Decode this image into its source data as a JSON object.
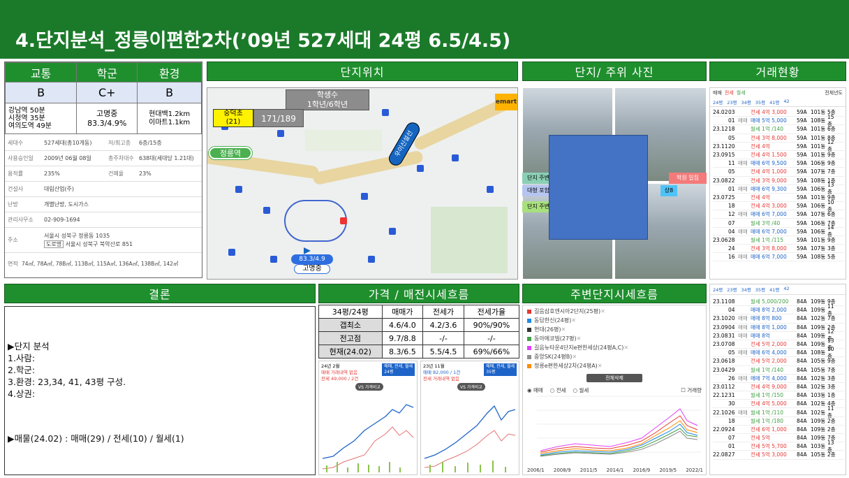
{
  "title": "4.단지분석_정릉이편한2차(’09년 527세대 24평 6.5/4.5)",
  "headers": {
    "traffic": "교통",
    "school": "학군",
    "env": "환경",
    "location": "단지위치",
    "photos": "단지/ 주위 사진",
    "deals": "거래현황",
    "conclusion": "결론",
    "price_trend": "가격 / 매전시세흐름",
    "nearby_trend": "주변단지시세흐름"
  },
  "grades": {
    "traffic": "B",
    "school": "C+",
    "env": "B"
  },
  "details": {
    "traffic": [
      "강남역 50분",
      "시청역 35분",
      "여의도역 49분"
    ],
    "school": [
      "고명중",
      "83.3/4.9%"
    ],
    "env": [
      "현대백1.2km",
      "이마트1.1km"
    ]
  },
  "info": [
    {
      "k": "세대수",
      "v": "527세대(총10개동)",
      "k2": "저/최고층",
      "v2": "6층/15층"
    },
    {
      "k": "사용승인일",
      "v": "2009년 06월 08일",
      "k2": "총주차대수",
      "v2": "638대(세대당 1.21대)"
    },
    {
      "k": "용적률",
      "v": "235%",
      "k2": "건폐율",
      "v2": "23%"
    },
    {
      "k": "건설사",
      "v": "대림산업(주)",
      "k2": "",
      "v2": ""
    },
    {
      "k": "난방",
      "v": "개별난방, 도시가스",
      "k2": "",
      "v2": ""
    },
    {
      "k": "관리사무소",
      "v": "02-909-1694",
      "k2": "",
      "v2": ""
    },
    {
      "k": "주소",
      "v": "서울시 성북구 정릉동 1035",
      "k2": "",
      "v2": ""
    },
    {
      "k": "면적",
      "v": "74㎡, 78A㎡, 78B㎡, 113B㎡, 115A㎡, 136A㎡, 138B㎡, 142㎡",
      "k2": "",
      "v2": ""
    }
  ],
  "address_road": "도로명",
  "address_road_value": "서울시 성북구 북악산로 851",
  "map": {
    "students_label": "학생수",
    "students_grades": "1학년/6학년",
    "school_name": "숭덕초",
    "school_rank": "(21)",
    "school_count": "171/189",
    "station": "정릉역",
    "emart": "emart",
    "rail": "우이신설선",
    "middle_score": "83.3/4.9",
    "middle_name": "고명중"
  },
  "photo_labels": [
    "단지 주변",
    "대형 포함",
    "단지 주변",
    "학원 밀집",
    "상8"
  ],
  "deal_tabs": {
    "sale": "매매",
    "jeonse": "전세",
    "monthly": "월세",
    "filter": "전체년도"
  },
  "deal_area_tabs": [
    "24평",
    "23평",
    "34평",
    "35평",
    "41평",
    "42"
  ],
  "deal_area_tabs2": [
    "24평",
    "23평",
    "34평",
    "35평",
    "41평",
    "42"
  ],
  "deals": [
    [
      "24.02",
      "03",
      "",
      "전세 4억 3,000",
      "59A",
      "101동",
      "5층"
    ],
    [
      "",
      "01",
      "매매",
      "매매 5억 5,000",
      "59A",
      "108동",
      "15층"
    ],
    [
      "23.12",
      "18",
      "",
      "월세 1억 /140",
      "59A",
      "101동",
      "6층"
    ],
    [
      "",
      "05",
      "",
      "전세 3억 8,000",
      "59A",
      "101동",
      "8층"
    ],
    [
      "23.11",
      "20",
      "",
      "전세 4억",
      "59A",
      "101동",
      "12층"
    ],
    [
      "23.09",
      "15",
      "",
      "전세 4억 1,500",
      "59A",
      "101동",
      "9층"
    ],
    [
      "",
      "11",
      "매매",
      "매매 6억 9,500",
      "59A",
      "106동",
      "9층"
    ],
    [
      "",
      "05",
      "",
      "전세 4억 1,000",
      "59A",
      "107동",
      "7층"
    ],
    [
      "23.08",
      "22",
      "",
      "전세 3억 9,000",
      "59A",
      "108동",
      "1층"
    ],
    [
      "",
      "01",
      "매매",
      "매매 6억 9,300",
      "59A",
      "106동",
      "13층"
    ],
    [
      "23.07",
      "25",
      "",
      "전세 4억",
      "59A",
      "101동",
      "9층"
    ],
    [
      "",
      "18",
      "",
      "전세 4억 3,000",
      "59A",
      "106동",
      "10층"
    ],
    [
      "",
      "12",
      "매매",
      "매매 6억 7,000",
      "59A",
      "107동",
      "6층"
    ],
    [
      "",
      "07",
      "",
      "월세 3억 /40",
      "59A",
      "106동",
      "7층"
    ],
    [
      "",
      "04",
      "매매",
      "매매 6억 7,000",
      "59A",
      "106동",
      "14층"
    ],
    [
      "23.06",
      "28",
      "",
      "월세 1억 /115",
      "59A",
      "101동",
      "9층"
    ],
    [
      "",
      "24",
      "",
      "전세 3억 8,000",
      "59A",
      "107동",
      "3층"
    ],
    [
      "",
      "16",
      "매매",
      "매매 6억 7,000",
      "59A",
      "108동",
      "5층"
    ]
  ],
  "deals2": [
    [
      "23.11",
      "08",
      "",
      "월세 5,000/200",
      "84A",
      "109동",
      "9층"
    ],
    [
      "",
      "04",
      "",
      "매매 8억 2,000",
      "84A",
      "109동",
      "11층"
    ],
    [
      "23.10",
      "20",
      "매매",
      "매매 8억 800",
      "84A",
      "102동",
      "7층"
    ],
    [
      "23.09",
      "04",
      "매매",
      "매매 8억 1,000",
      "84A",
      "109동",
      "2층"
    ],
    [
      "23.08",
      "31",
      "매매",
      "매매 8억",
      "84A",
      "109동",
      "12층"
    ],
    [
      "23.07",
      "08",
      "",
      "전세 5억 2,000",
      "84A",
      "109동",
      "13층"
    ],
    [
      "",
      "05",
      "매매",
      "매매 6억 4,000",
      "84A",
      "108동",
      "10층"
    ],
    [
      "23.06",
      "18",
      "",
      "전세 5억 2,000",
      "84A",
      "105동",
      "9층"
    ],
    [
      "23.04",
      "29",
      "",
      "월세 1억 /140",
      "84A",
      "105동",
      "7층"
    ],
    [
      "",
      "26",
      "매매",
      "매매 7억 4,000",
      "84A",
      "102동",
      "3층"
    ],
    [
      "23.01",
      "12",
      "",
      "전세 4억 9,000",
      "84A",
      "102동",
      "3층"
    ],
    [
      "22.12",
      "31",
      "",
      "월세 1억 /150",
      "84A",
      "103동",
      "1층"
    ],
    [
      "",
      "30",
      "",
      "전세 4억 5,000",
      "84A",
      "102동",
      "4층"
    ],
    [
      "22.10",
      "26",
      "매매",
      "월세 1억 /110",
      "84A",
      "102동",
      "11층"
    ],
    [
      "",
      "18",
      "",
      "월세 1억 /180",
      "84A",
      "109동",
      "2층"
    ],
    [
      "22.09",
      "24",
      "",
      "전세 6억 1,000",
      "84A",
      "109동",
      "2층"
    ],
    [
      "",
      "07",
      "",
      "전세 5억",
      "84A",
      "109동",
      "7층"
    ],
    [
      "",
      "01",
      "",
      "전세 5억 5,700",
      "84A",
      "103동",
      "13층"
    ],
    [
      "22.08",
      "27",
      "",
      "전세 5억 3,000",
      "84A",
      "105동",
      "2층"
    ]
  ],
  "conclusion": {
    "heading": "▶단지 분석",
    "items": [
      "1.사람:",
      "2.학군:",
      "3.환경: 23,34, 41, 43평 구성.",
      "4.상권:"
    ],
    "stock": "▶매물(24.02) : 매매(29) / 전세(10) / 월세(1)"
  },
  "price_table": {
    "head": [
      "34평/24평",
      "매매가",
      "전세가",
      "전세가율"
    ],
    "rows": [
      [
        "갭최소",
        "4.6/4.0",
        "4.2/3.6",
        "90%/90%"
      ],
      [
        "전고점",
        "9.7/8.8",
        "-/-",
        "-/-"
      ],
      [
        "현재(24.02)",
        "8.3/6.5",
        "5.5/4.5",
        "69%/66%"
      ]
    ]
  },
  "mini_chart_left": {
    "title": "24년 2월",
    "sub1": "매매 거래내역 없음",
    "sub2": "전세 49,000 / 2건",
    "badge": "매매, 전세, 월세",
    "badge2": "24평",
    "vs": "VS 가격비교"
  },
  "mini_chart_right": {
    "title": "23년 11월",
    "sub1": "매매 82,000 / 1건",
    "sub2": "전세 거래내역 없음",
    "badge": "매매, 전세, 월세",
    "badge2": "35평",
    "vs": "VS 가격비교"
  },
  "nearby_legend": [
    {
      "name": "길음삼호엔시아2단지(25평)",
      "color": "#e53935"
    },
    {
      "name": "동답한신(24평)",
      "color": "#1e88e5"
    },
    {
      "name": "현대(26평)",
      "color": "#333333"
    },
    {
      "name": "동아에코빌(27평)",
      "color": "#43a047"
    },
    {
      "name": "길음뉴타운4단지e편한세상(24평A,C)",
      "color": "#e040fb"
    },
    {
      "name": "중앙SK(24평B)",
      "color": "#8e8e8e"
    },
    {
      "name": "정릉e편한세상2차(24평A)",
      "color": "#fb8c00"
    }
  ],
  "nearby_btn": "전체삭제",
  "nearby_modes": [
    "매매",
    "전세",
    "월세"
  ],
  "nearby_vol": "거래량",
  "nearby_xticks": [
    "2006/1",
    "2008/9",
    "2011/5",
    "2014/1",
    "2016/9",
    "2019/5",
    "2022/1"
  ]
}
